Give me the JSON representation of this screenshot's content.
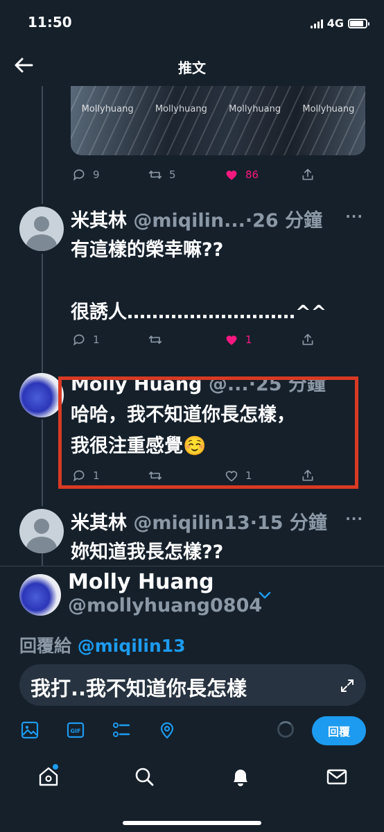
{
  "status_bar": {
    "time": "11:50",
    "network": "4G"
  },
  "header": {
    "title": "推文"
  },
  "media": {
    "watermark": "Mollyhuang",
    "watermarks": [
      "Mollyhuang",
      "Mollyhuang",
      "Mollyhuang",
      "Mollyhuang"
    ]
  },
  "main_tweet_actions": {
    "replies": "9",
    "retweets": "5",
    "likes": "86"
  },
  "replies": [
    {
      "name": "米其林",
      "handle": "@miqilin...",
      "time": "·26 分鐘",
      "text": "有這樣的榮幸嘛??\n\n很誘人………………………^^",
      "replies": "1",
      "retweets": "",
      "likes": "1",
      "liked": true
    },
    {
      "name": "Molly Huang",
      "handle": "@...",
      "time": "·25 分鐘",
      "text": "哈哈，我不知道你長怎樣，\n我很注重感覺☺️",
      "replies": "1",
      "retweets": "",
      "likes": "1",
      "liked": false
    },
    {
      "name": "米其林",
      "handle": "@miqilin13",
      "time": "·15 分鐘",
      "text": "妳知道我長怎樣??"
    }
  ],
  "composer": {
    "name": "Molly Huang",
    "handle": "@mollyhuang0804",
    "reply_to_prefix": "回覆給 ",
    "reply_to_handle": "@miqilin13",
    "input_value": "我打..我不知道你長怎樣",
    "reply_button": "回覆",
    "gif_label": "GIF"
  },
  "icons": {
    "back": "arrow-left-icon",
    "reply": "chat-bubble-icon",
    "retweet": "retweet-icon",
    "like": "heart-icon",
    "share": "share-icon",
    "more": "more-icon",
    "image": "image-icon",
    "gif": "gif-icon",
    "poll": "poll-icon",
    "location": "location-icon",
    "expand": "expand-icon",
    "home": "home-icon",
    "search": "search-icon",
    "notifications": "bell-icon",
    "messages": "mail-icon"
  },
  "colors": {
    "background": "#15202b",
    "accent": "#1d9bf0",
    "like": "#f91880",
    "highlight": "#d83a23",
    "muted": "#8b98a5"
  }
}
